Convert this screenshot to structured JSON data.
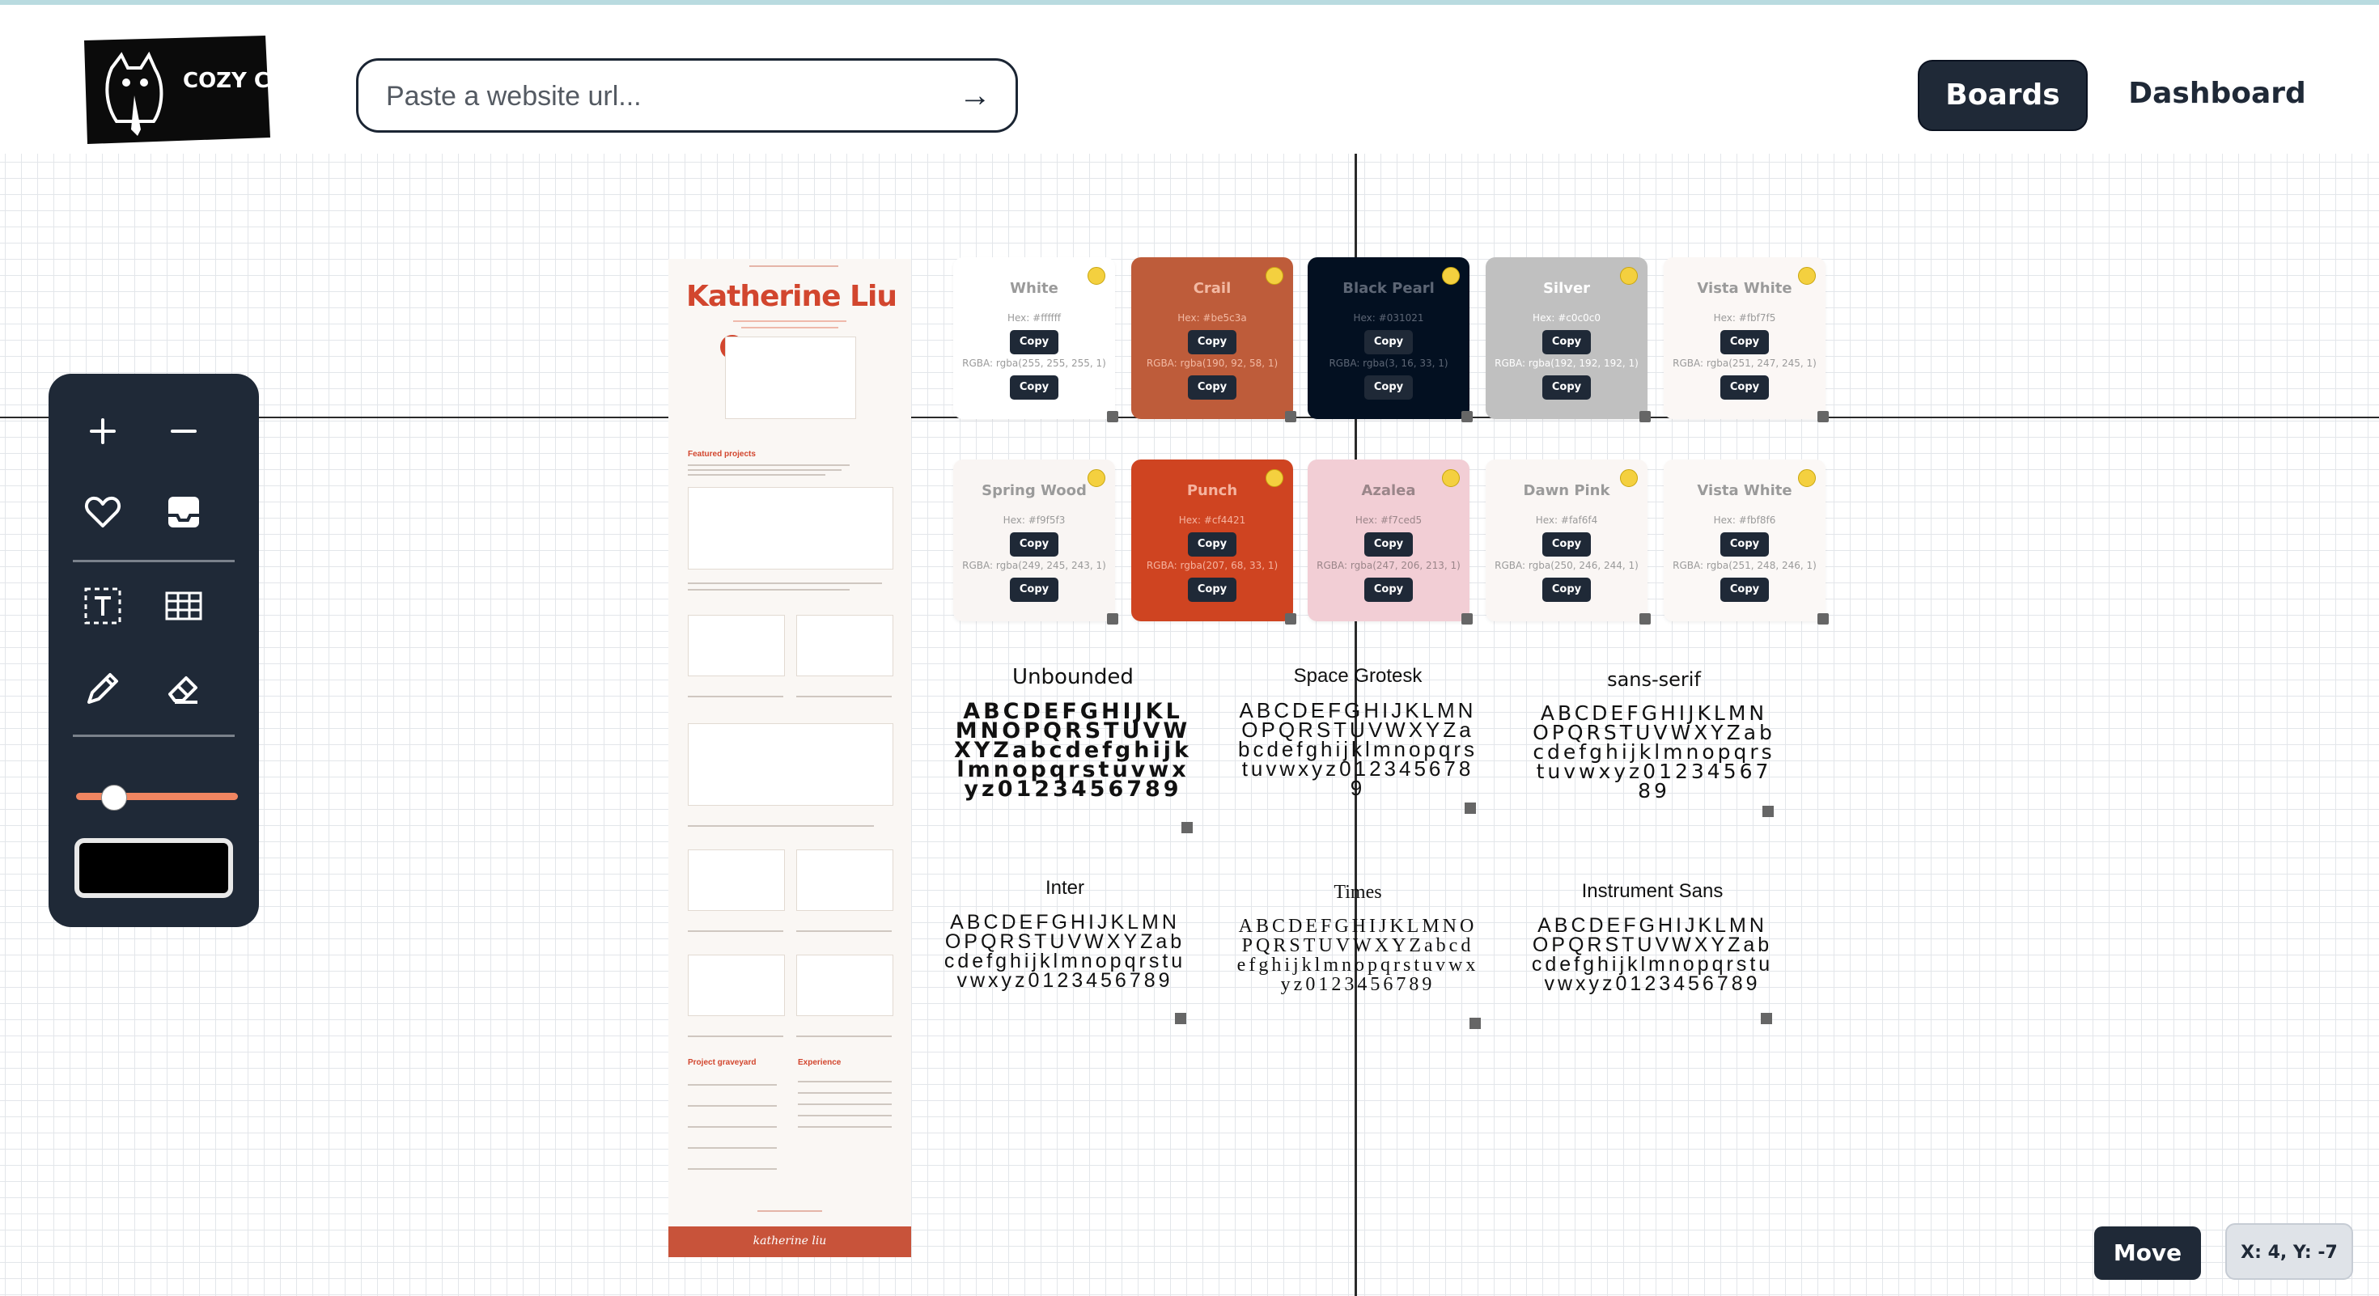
{
  "header": {
    "logo_text": "COZY CORNER CREW",
    "search_placeholder": "Paste a website url...",
    "search_submit_icon": "arrow-right-icon",
    "nav": [
      {
        "label": "Boards",
        "active": true
      },
      {
        "label": "Dashboard",
        "active": false
      }
    ]
  },
  "toolbar": {
    "tools": [
      "zoom-in-icon",
      "zoom-out-icon",
      "heart-icon",
      "inbox-icon",
      "text-box-icon",
      "table-icon",
      "pencil-icon",
      "eraser-icon"
    ],
    "slider_value": 0.18,
    "slider_color": "#f08561",
    "current_color": "#000000"
  },
  "screenshot_card": {
    "title": "Katherine Liu",
    "section_featured": "Featured projects",
    "section_graveyard": "Project graveyard",
    "section_experience": "Experience",
    "footer": "katherine liu"
  },
  "palette": [
    {
      "name": "White",
      "hex": "Hex: #ffffff",
      "rgba": "RGBA: rgba(255, 255, 255, 1)",
      "bg": "#ffffff",
      "fg": "#9a9a9a",
      "copy": "Copy"
    },
    {
      "name": "Crail",
      "hex": "Hex: #be5c3a",
      "rgba": "RGBA: rgba(190, 92, 58, 1)",
      "bg": "#be5c3a",
      "fg": "#f2b9a3",
      "copy": "Copy"
    },
    {
      "name": "Black Pearl",
      "hex": "Hex: #031021",
      "rgba": "RGBA: rgba(3, 16, 33, 1)",
      "bg": "#031021",
      "fg": "#5d6675",
      "copy": "Copy"
    },
    {
      "name": "Silver",
      "hex": "Hex: #c0c0c0",
      "rgba": "RGBA: rgba(192, 192, 192, 1)",
      "bg": "#c0c0c0",
      "fg": "#ffffff",
      "copy": "Copy"
    },
    {
      "name": "Vista White",
      "hex": "Hex: #fbf7f5",
      "rgba": "RGBA: rgba(251, 247, 245, 1)",
      "bg": "#fbf7f5",
      "fg": "#9a9a9a",
      "copy": "Copy"
    },
    {
      "name": "Spring Wood",
      "hex": "Hex: #f9f5f3",
      "rgba": "RGBA: rgba(249, 245, 243, 1)",
      "bg": "#f9f5f3",
      "fg": "#9a9a9a",
      "copy": "Copy"
    },
    {
      "name": "Punch",
      "hex": "Hex: #cf4421",
      "rgba": "RGBA: rgba(207, 68, 33, 1)",
      "bg": "#cf4421",
      "fg": "#f5b39f",
      "copy": "Copy"
    },
    {
      "name": "Azalea",
      "hex": "Hex: #f7ced5",
      "rgba": "RGBA: rgba(247, 206, 213, 1)",
      "bg": "#f2ced5",
      "fg": "#9a8589",
      "copy": "Copy"
    },
    {
      "name": "Dawn Pink",
      "hex": "Hex: #faf6f4",
      "rgba": "RGBA: rgba(250, 246, 244, 1)",
      "bg": "#faf6f4",
      "fg": "#9a9a9a",
      "copy": "Copy"
    },
    {
      "name": "Vista White",
      "hex": "Hex: #fbf8f6",
      "rgba": "RGBA: rgba(251, 248, 246, 1)",
      "bg": "#fbf8f6",
      "fg": "#9a9a9a",
      "copy": "Copy"
    }
  ],
  "fonts": [
    {
      "name": "Unbounded",
      "sample": "ABCDEFGHIJKLMNOPQRSTUVWXYZabcdefghijklmnopqrstuvwxyz0123456789"
    },
    {
      "name": "Space Grotesk",
      "sample": "ABCDEFGHIJKLMNOPQRSTUVWXYZabcdefghijklmnopqrstuvwxyz0123456789"
    },
    {
      "name": "sans-serif",
      "sample": "ABCDEFGHIJKLMNOPQRSTUVWXYZabcdefghijklmnopqrstuvwxyz0123456789"
    },
    {
      "name": "Inter",
      "sample": "ABCDEFGHIJKLMNOPQRSTUVWXYZabcdefghijklmnopqrstuvwxyz0123456789"
    },
    {
      "name": "Times",
      "sample": "ABCDEFGHIJKLMNOPQRSTUVWXYZabcdefghijklmnopqrstuvwxyz0123456789"
    },
    {
      "name": "Instrument Sans",
      "sample": "ABCDEFGHIJKLMNOPQRSTUVWXYZabcdefghijklmnopqrstuvwxyz0123456789"
    }
  ],
  "footer": {
    "move_label": "Move",
    "coords": "X: 4, Y: -7"
  }
}
